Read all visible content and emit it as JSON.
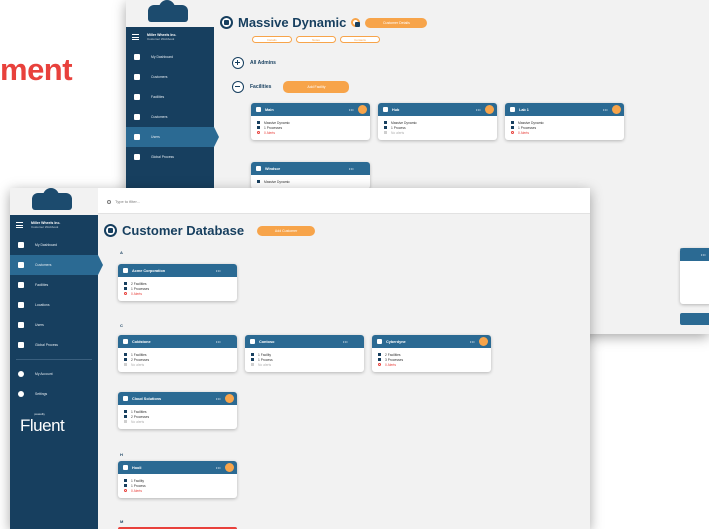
{
  "headline": "ment",
  "back_window": {
    "sidebar": {
      "company_name": "Miller Wheels Inc.",
      "company_sub": "Customer Workbook",
      "items": [
        {
          "label": "My Dashboard",
          "active": false
        },
        {
          "label": "Customers",
          "active": false
        },
        {
          "label": "Facilities",
          "active": false
        },
        {
          "label": "Customers",
          "active": false
        },
        {
          "label": "Users",
          "active": true
        },
        {
          "label": "Global Process",
          "active": false
        }
      ]
    },
    "title": "Massive Dynamic",
    "pill_label": "Customer Details",
    "sub_pills": [
      "Details",
      "Notes",
      "Contacts"
    ],
    "sections": [
      {
        "label": "All Admins",
        "icon": "plus-icon"
      },
      {
        "label": "Facilities",
        "icon": "minus-icon",
        "pill": "Add Facility"
      }
    ],
    "cards": [
      {
        "name": "Main",
        "lines": [
          "Massive Dynamic",
          "1 Processes"
        ],
        "alert": "0 Alerts"
      },
      {
        "name": "Hub",
        "lines": [
          "Massive Dynamic",
          "1 Process"
        ],
        "muted": "No alerts"
      },
      {
        "name": "Lab 1",
        "lines": [
          "Massive Dynamic",
          "1 Processes"
        ],
        "alert": "0 Alerts"
      },
      {
        "name": "Windsor",
        "lines": [
          "Massive Dynamic"
        ]
      }
    ]
  },
  "front_window": {
    "search_placeholder": "Type to filter...",
    "sidebar": {
      "company_name": "Miller Wheels Inc.",
      "company_sub": "Customer Workbook",
      "items": [
        {
          "label": "My Dashboard",
          "active": false
        },
        {
          "label": "Customers",
          "active": true
        },
        {
          "label": "Facilities",
          "active": false
        },
        {
          "label": "Locations",
          "active": false
        },
        {
          "label": "Users",
          "active": false
        },
        {
          "label": "Global Process",
          "active": false
        }
      ],
      "bottom_items": [
        {
          "label": "My Account"
        },
        {
          "label": "Settings"
        }
      ],
      "brand": "Fluent",
      "brand_sub": "powered by"
    },
    "title": "Customer Database",
    "pill_label": "Add Customer",
    "groups": [
      {
        "letter": "A",
        "cards": [
          {
            "name": "Acme Corporation",
            "lines": [
              "2 Facilities",
              "1 Processes"
            ],
            "alert": "0 Alerts"
          }
        ]
      },
      {
        "letter": "C",
        "cards": [
          {
            "name": "Coldstone",
            "lines": [
              "1 Facilities",
              "2 Processes"
            ],
            "muted": "No alerts"
          },
          {
            "name": "Contoso",
            "lines": [
              "1 Facility",
              "1 Process"
            ],
            "muted": "No alerts"
          },
          {
            "name": "Cyberdyne",
            "lines": [
              "2 Facilities",
              "3 Processes"
            ],
            "alert": "0 Alerts"
          },
          {
            "name": "Cloud Solutions",
            "lines": [
              "1 Facilities",
              "2 Processes"
            ],
            "muted": "No alerts"
          }
        ]
      },
      {
        "letter": "H",
        "cards": [
          {
            "name": "Hooli",
            "lines": [
              "1 Facility",
              "1 Process"
            ],
            "alert": "0 Alerts"
          }
        ]
      },
      {
        "letter": "M",
        "cards": []
      }
    ]
  },
  "colors": {
    "navy": "#173f5f",
    "accent_blue": "#2b6a93",
    "orange": "#f7a44a",
    "red": "#e8413c"
  }
}
